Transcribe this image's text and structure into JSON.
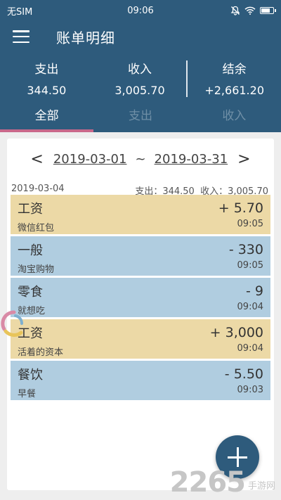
{
  "status": {
    "carrier": "无SIM",
    "time": "09:06",
    "battery_level": 0.8
  },
  "appbar": {
    "title": "账单明细"
  },
  "summary": {
    "expense_label": "支出",
    "expense_value": "344.50",
    "income_label": "收入",
    "income_value": "3,005.70",
    "balance_label": "结余",
    "balance_value": "+2,661.20"
  },
  "tabs": [
    {
      "label": "全部"
    },
    {
      "label": "支出"
    },
    {
      "label": "收入"
    }
  ],
  "range": {
    "prev": "<",
    "start": "2019-03-01",
    "sep": "~",
    "end": "2019-03-31",
    "next": ">"
  },
  "day": {
    "date": "2019-03-04",
    "totals": "支出：344.50  收入：3,005.70"
  },
  "entries": [
    {
      "category": "工资",
      "note": "微信红包",
      "amount": "+ 5.70",
      "time": "09:05",
      "kind": "income"
    },
    {
      "category": "一般",
      "note": "淘宝购物",
      "amount": "- 330",
      "time": "09:05",
      "kind": "expense"
    },
    {
      "category": "零食",
      "note": "就想吃",
      "amount": "- 9",
      "time": "09:04",
      "kind": "expense"
    },
    {
      "category": "工资",
      "note": "活着的资本",
      "amount": "+ 3,000",
      "time": "09:04",
      "kind": "income"
    },
    {
      "category": "餐饮",
      "note": "早餐",
      "amount": "- 5.50",
      "time": "09:03",
      "kind": "expense"
    }
  ],
  "watermark": {
    "number": "2265",
    "text": "手游网"
  },
  "colors": {
    "primary": "#2e5b7c",
    "income_bg": "#ecd9a6",
    "expense_bg": "#b0cde0",
    "tab_indicator": "#c9688a"
  }
}
